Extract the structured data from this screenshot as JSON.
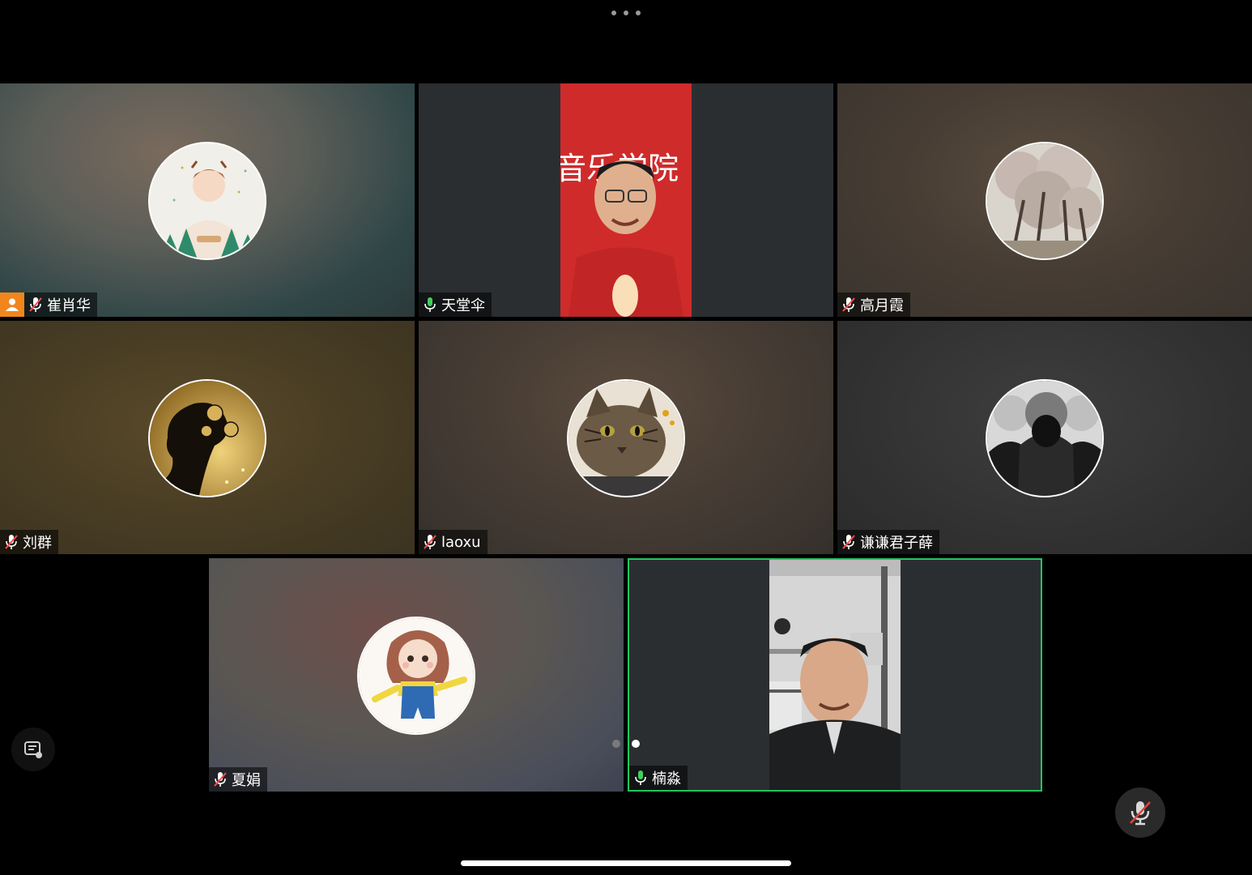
{
  "participants": [
    {
      "name": "崔肖华",
      "mic": "muted",
      "host": true,
      "avatar": "illustrated-girl-avatar"
    },
    {
      "name": "天堂伞",
      "mic": "on",
      "host": false,
      "video": true,
      "backdrop_text": "音乐学院"
    },
    {
      "name": "高月霞",
      "mic": "muted",
      "host": false,
      "avatar": "cherry-blossom-avatar"
    },
    {
      "name": "刘群",
      "mic": "muted",
      "host": false,
      "avatar": "golden-silhouette-avatar"
    },
    {
      "name": "laoxu",
      "mic": "muted",
      "host": false,
      "avatar": "cat-avatar"
    },
    {
      "name": "谦谦君子薛",
      "mic": "muted",
      "host": false,
      "avatar": "grayscale-group-avatar"
    },
    {
      "name": "夏娟",
      "mic": "muted",
      "host": false,
      "avatar": "cartoon-doll-avatar"
    },
    {
      "name": "楠淼",
      "mic": "on",
      "host": false,
      "video": true,
      "active_speaker": true
    }
  ],
  "pagination": {
    "pages": 2,
    "current": 2
  },
  "colors": {
    "active_border": "#22c55e",
    "mic_on": "#3fd15a",
    "mic_muted": "#ff4d4f",
    "host_badge": "#f0861d"
  },
  "icons": {
    "more": "ellipsis-icon",
    "chat": "chat-bubble-icon",
    "mute": "mic-off-icon"
  }
}
